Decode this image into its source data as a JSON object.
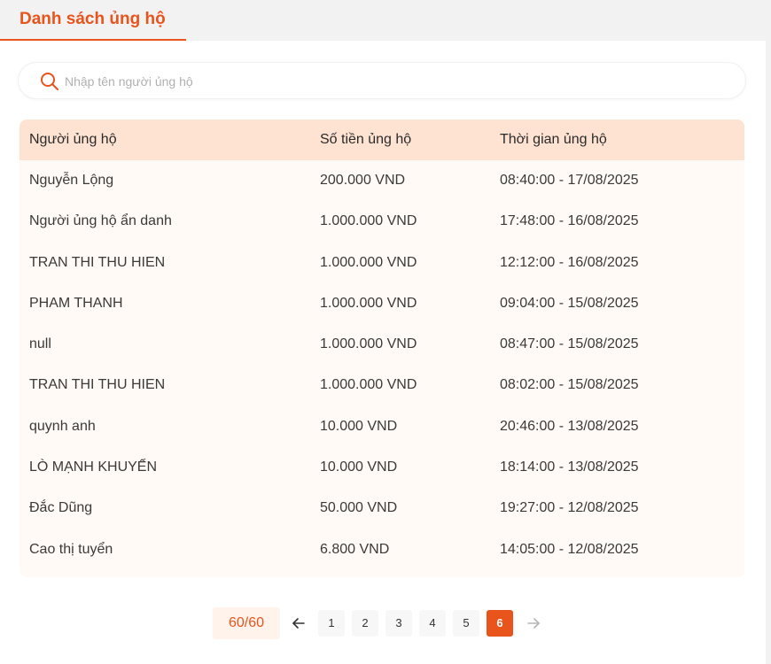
{
  "tabs": [
    {
      "label": "Danh sách ủng hộ",
      "active": true
    }
  ],
  "search": {
    "placeholder": "Nhập tên người ủng hộ",
    "value": ""
  },
  "table": {
    "columns": [
      "Người ủng hộ",
      "Số tiền ủng hộ",
      "Thời gian ủng hộ"
    ],
    "rows": [
      {
        "name": "Nguyễn Lộng",
        "amount": "200.000 VND",
        "time": "08:40:00 - 17/08/2025"
      },
      {
        "name": "Người ủng hộ ẩn danh",
        "amount": "1.000.000 VND",
        "time": "17:48:00 - 16/08/2025"
      },
      {
        "name": "TRAN THI THU HIEN",
        "amount": "1.000.000 VND",
        "time": "12:12:00 - 16/08/2025"
      },
      {
        "name": "PHAM THANH",
        "amount": "1.000.000 VND",
        "time": "09:04:00 - 15/08/2025"
      },
      {
        "name": "null",
        "amount": "1.000.000 VND",
        "time": "08:47:00 - 15/08/2025"
      },
      {
        "name": "TRAN THI THU HIEN",
        "amount": "1.000.000 VND",
        "time": "08:02:00 - 15/08/2025"
      },
      {
        "name": "quynh anh",
        "amount": "10.000 VND",
        "time": "20:46:00 - 13/08/2025"
      },
      {
        "name": "LÒ MẠNH KHUYẾN",
        "amount": "10.000 VND",
        "time": "18:14:00 - 13/08/2025"
      },
      {
        "name": "Đắc Dũng",
        "amount": "50.000 VND",
        "time": "19:27:00 - 12/08/2025"
      },
      {
        "name": "Cao thị tuyển",
        "amount": "6.800 VND",
        "time": "14:05:00 - 12/08/2025"
      }
    ]
  },
  "pagination": {
    "count": "60/60",
    "pages": [
      "1",
      "2",
      "3",
      "4",
      "5",
      "6"
    ],
    "current": "6"
  },
  "icons": {
    "search": "search-icon",
    "prev": "arrow-left-icon",
    "next": "arrow-right-icon"
  },
  "colors": {
    "accent": "#e8541c",
    "header_bg": "#ffe3d2",
    "row_bg": "#fffaf5"
  }
}
